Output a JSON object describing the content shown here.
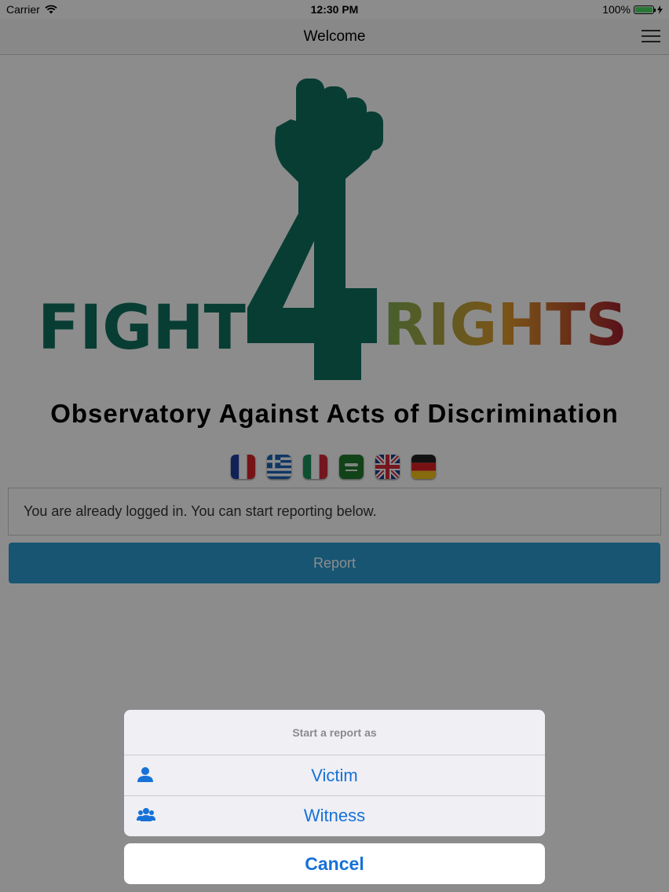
{
  "status_bar": {
    "carrier": "Carrier",
    "time": "12:30 PM",
    "battery": "100%",
    "battery_level": 1.0
  },
  "nav": {
    "title": "Welcome"
  },
  "logo": {
    "left_word": "FIGHT",
    "number": "4",
    "right_word": "RIGHTS",
    "colors": {
      "green": "#10705e",
      "gradient_start": "#7fae52",
      "gradient_mid": "#e09a2c",
      "gradient_end": "#a11c2f"
    }
  },
  "subtitle": "Observatory Against Acts of Discrimination",
  "flags": [
    {
      "name": "france-flag",
      "icon": "flag-fr"
    },
    {
      "name": "greece-flag",
      "icon": "flag-gr"
    },
    {
      "name": "italy-flag",
      "icon": "flag-it"
    },
    {
      "name": "saudi-arabia-flag",
      "icon": "flag-sa"
    },
    {
      "name": "united-kingdom-flag",
      "icon": "flag-uk"
    },
    {
      "name": "germany-flag",
      "icon": "flag-de"
    }
  ],
  "info_message": "You are already logged in. You can start reporting below.",
  "report_button": "Report",
  "action_sheet": {
    "title": "Start a report as",
    "options": [
      {
        "label": "Victim",
        "icon": "person-icon"
      },
      {
        "label": "Witness",
        "icon": "group-icon"
      }
    ],
    "cancel": "Cancel"
  },
  "colors": {
    "accent": "#1671d8",
    "report_button": "#2b9cd2",
    "overlay": "rgba(0,0,0,0.45)"
  }
}
